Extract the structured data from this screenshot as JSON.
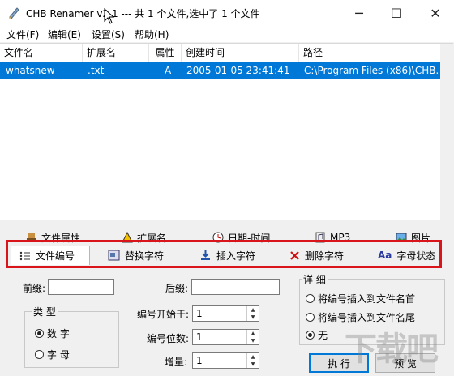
{
  "window": {
    "title": "CHB Renamer v2.1 --- 共 1 个文件,选中了 1 个文件",
    "minimize_glyph": "─",
    "maximize_glyph": "☐",
    "close_glyph": "✕"
  },
  "menu": {
    "items": [
      "文件(F)",
      "编辑(E)",
      "设置(S)",
      "帮助(H)"
    ]
  },
  "filelist": {
    "columns": [
      "文件名",
      "扩展名",
      "属性",
      "创建时间",
      "路径"
    ],
    "rows": [
      {
        "name": "whatsnew",
        "ext": ".txt",
        "attr": "A",
        "created": "2005-01-05 23:41:41",
        "path": "C:\\Program Files (x86)\\CHB..."
      }
    ]
  },
  "back_tabs": [
    {
      "label": "文件属性",
      "icon": "stamp-icon"
    },
    {
      "label": "扩展名",
      "icon": "warning-icon"
    },
    {
      "label": "日期-时间",
      "icon": "clock-icon"
    },
    {
      "label": "MP3",
      "icon": "mp3-icon"
    },
    {
      "label": "图片",
      "icon": "image-icon"
    }
  ],
  "front_tabs": [
    {
      "label": "文件编号",
      "icon": "list-icon",
      "active": true
    },
    {
      "label": "替换字符",
      "icon": "replace-icon"
    },
    {
      "label": "插入字符",
      "icon": "insert-icon"
    },
    {
      "label": "删除字符",
      "icon": "delete-x-icon"
    },
    {
      "label": "字母状态",
      "icon": "font-case-icon",
      "icon_text": "Aa"
    }
  ],
  "form": {
    "prefix_label": "前缀:",
    "prefix_value": "",
    "suffix_label": "后缀:",
    "suffix_value": "",
    "type_group": {
      "title": "类 型",
      "options": [
        "数 字",
        "字 母"
      ],
      "selected": 0
    },
    "start_label": "编号开始于:",
    "start_value": "1",
    "digits_label": "编号位数:",
    "digits_value": "1",
    "increment_label": "增量:",
    "increment_value": "1",
    "detail_group": {
      "title": "详 细",
      "options": [
        "将编号插入到文件名首",
        "将编号插入到文件名尾",
        "无"
      ],
      "selected": 2
    },
    "execute_label": "执 行",
    "preview_label": "预 览"
  },
  "watermark_text": "下载吧",
  "colors": {
    "selection": "#0078d7",
    "highlight_box": "#d9141a"
  }
}
